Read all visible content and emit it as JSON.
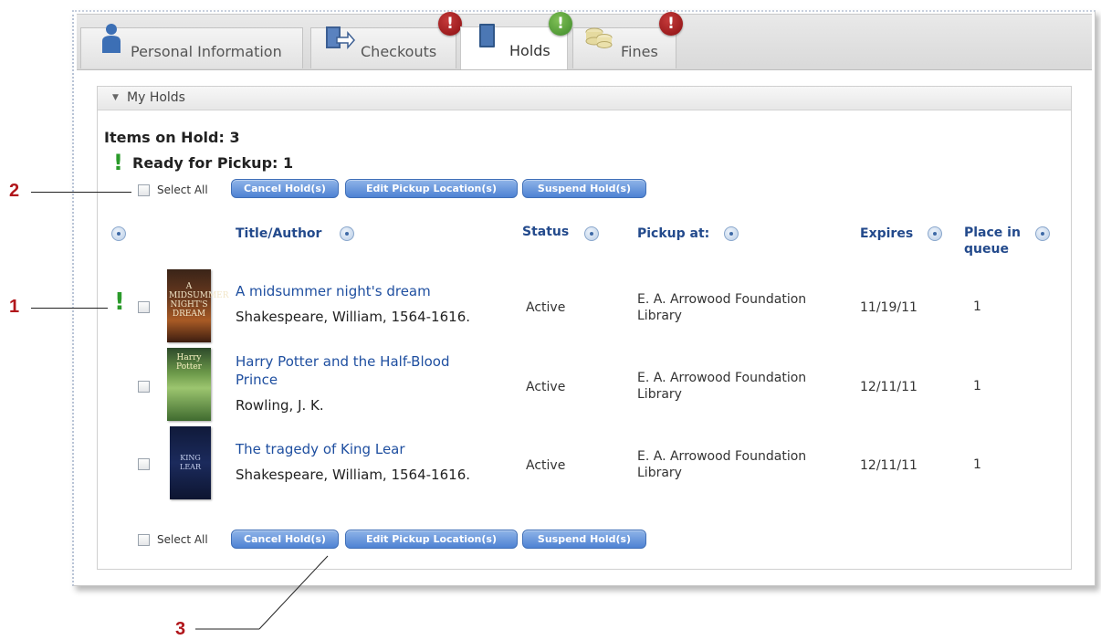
{
  "tabs": [
    {
      "label": "Personal Information",
      "icon": "person-icon"
    },
    {
      "label": "Checkouts",
      "icon": "checkout-book-icon",
      "badge": "!",
      "badge_color": "#8b0f12"
    },
    {
      "label": "Holds",
      "icon": "book-icon",
      "badge": "!",
      "badge_color": "#3e8a2a"
    },
    {
      "label": "Fines",
      "icon": "coins-icon",
      "badge": "!",
      "badge_color": "#8b0f12"
    }
  ],
  "panel": {
    "title": "My Holds",
    "items_on_hold": "Items on Hold: 3",
    "ready_for_pickup": "Ready for Pickup: 1"
  },
  "toolbar": {
    "select_all": "Select All",
    "cancel": "Cancel Hold(s)",
    "edit_pickup": "Edit Pickup Location(s)",
    "suspend": "Suspend Hold(s)"
  },
  "columns": {
    "title_author": "Title/Author",
    "status": "Status",
    "pickup_at": "Pickup at:",
    "expires": "Expires",
    "place_in_queue_1": "Place in",
    "place_in_queue_2": "queue"
  },
  "holds": [
    {
      "title": "A midsummer night's dream",
      "author": "Shakespeare, William, 1564-1616.",
      "status": "Active",
      "pickup_1": "E. A. Arrowood Foundation",
      "pickup_2": "Library",
      "expires": "11/19/11",
      "queue": "1",
      "ready": true,
      "cover_text": "A MIDSUMMER NIGHT'S DREAM"
    },
    {
      "title_1": "Harry Potter and the Half-Blood",
      "title_2": "Prince",
      "author": "Rowling, J. K.",
      "status": "Active",
      "pickup_1": "E. A. Arrowood Foundation",
      "pickup_2": "Library",
      "expires": "12/11/11",
      "queue": "1",
      "ready": false,
      "cover_text": "Harry Potter"
    },
    {
      "title": "The tragedy of King Lear",
      "author": "Shakespeare, William, 1564-1616.",
      "status": "Active",
      "pickup_1": "E. A. Arrowood Foundation",
      "pickup_2": "Library",
      "expires": "12/11/11",
      "queue": "1",
      "ready": false,
      "cover_text": "KING LEAR"
    }
  ],
  "callouts": [
    "1",
    "2",
    "3"
  ],
  "colors": {
    "accent_link": "#1f4fa0",
    "ready_green": "#2a9a2a",
    "callout_red": "#b1161b",
    "button_blue": "#4e82d3"
  }
}
